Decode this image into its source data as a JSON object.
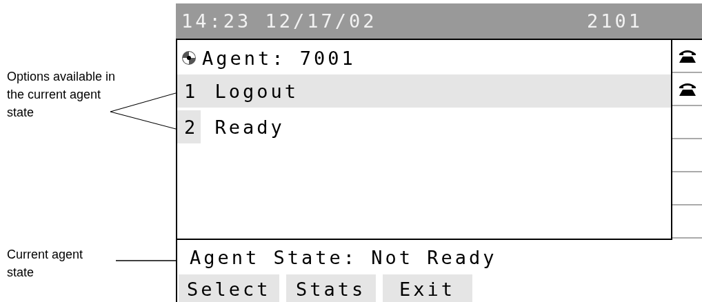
{
  "header": {
    "datetime": "14:23 12/17/02",
    "extension": "2101"
  },
  "agent": {
    "label": "Agent: 7001"
  },
  "options": [
    {
      "key": "1",
      "label": "Logout",
      "selected": true
    },
    {
      "key": "2",
      "label": "Ready",
      "selected": false
    }
  ],
  "lines": [
    {
      "kind": "phone"
    },
    {
      "kind": "phone"
    },
    {
      "kind": "blank"
    },
    {
      "kind": "blank"
    },
    {
      "kind": "blank"
    },
    {
      "kind": "blank"
    }
  ],
  "status": "Agent State: Not Ready",
  "softkeys": [
    "Select",
    "Stats",
    "Exit"
  ],
  "annotations": [
    {
      "kind": "options",
      "text": "Options available in the current agent state"
    },
    {
      "kind": "state",
      "text": "Current agent state"
    }
  ]
}
